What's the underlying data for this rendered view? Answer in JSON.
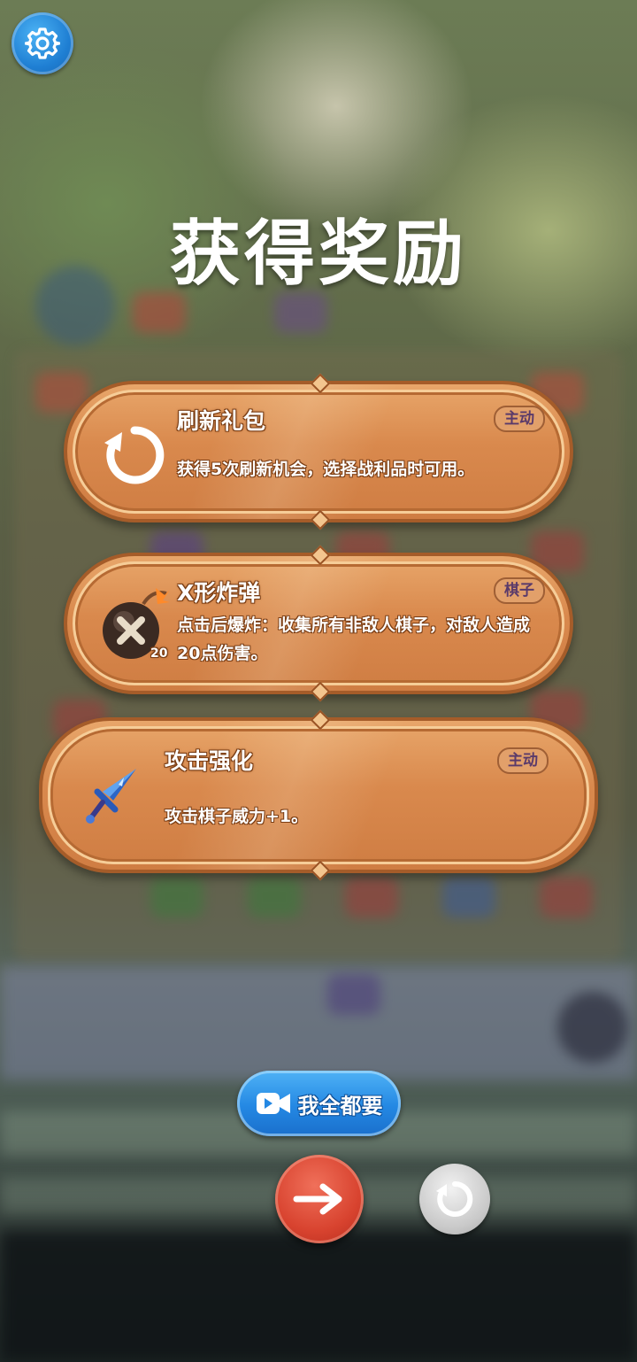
{
  "title": "获得奖励",
  "icons": {
    "settings": "gear-icon",
    "watch_ad": "video-camera-icon",
    "next": "arrow-right-icon",
    "refresh": "refresh-icon"
  },
  "rewards": [
    {
      "name": "刷新礼包",
      "tag": "主动",
      "description": "获得5次刷新机会，选择战利品时可用。",
      "icon": "refresh-icon"
    },
    {
      "name": "X形炸弹",
      "tag": "棋子",
      "description": "点击后爆炸：收集所有非敌人棋子，对敌人造成20点伤害。",
      "icon": "bomb-icon",
      "icon_badge": "20"
    },
    {
      "name": "攻击强化",
      "tag": "主动",
      "description": "攻击棋子威力+1。",
      "icon": "sword-icon"
    }
  ],
  "buttons": {
    "take_all_label": "我全都要"
  },
  "colors": {
    "card_fill": "#d9894d",
    "blue_button": "#2488e3",
    "red_button": "#d8432f",
    "grey_button": "#c9c9c9"
  }
}
